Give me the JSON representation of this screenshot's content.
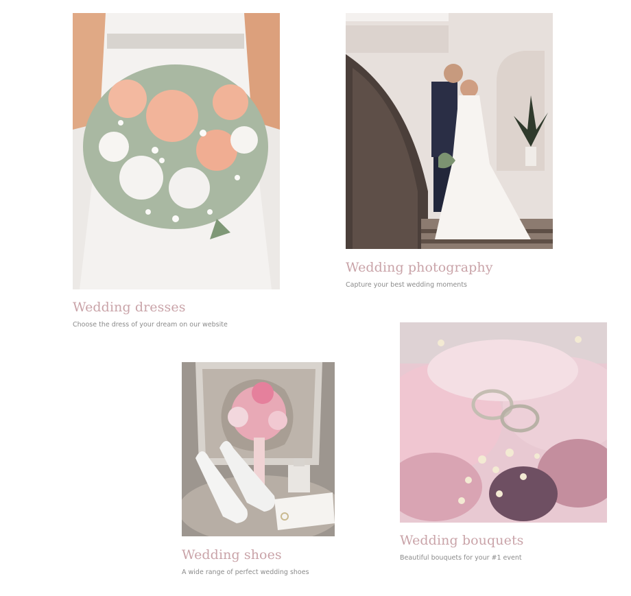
{
  "cards": [
    {
      "key": "dresses",
      "image_subject": "bride holding peach rose bouquet",
      "title": "Wedding dresses",
      "description": "Choose the dress of your dream on our website"
    },
    {
      "key": "photography",
      "image_subject": "couple kissing on ornate staircase",
      "title": "Wedding photography",
      "description": "Capture your best wedding moments"
    },
    {
      "key": "shoes",
      "image_subject": "white heels with pink bouquet on chair",
      "title": "Wedding shoes",
      "description": "A wide range of perfect wedding shoes"
    },
    {
      "key": "bouquets",
      "image_subject": "wedding rings on pink flowers",
      "title": "Wedding bouquets",
      "description": "Beautiful bouquets for your #1 event"
    }
  ],
  "colors": {
    "title": "#c9a3a8",
    "description": "#8a8a8a"
  }
}
